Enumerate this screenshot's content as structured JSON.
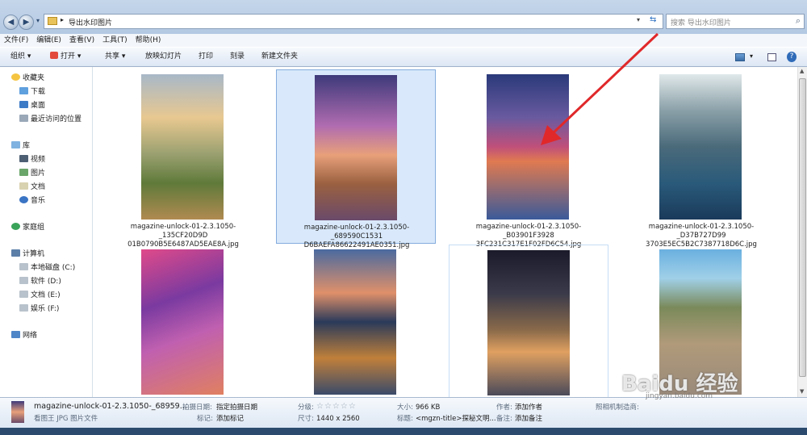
{
  "address": {
    "path": "导出水印图片",
    "search_placeholder": "搜索 导出水印图片"
  },
  "menu": [
    "文件(F)",
    "编辑(E)",
    "查看(V)",
    "工具(T)",
    "帮助(H)"
  ],
  "toolbar": {
    "organize": "组织",
    "open": "打开",
    "share": "共享",
    "slideshow": "放映幻灯片",
    "print": "打印",
    "burn": "刻录",
    "new_folder": "新建文件夹"
  },
  "sidebar": {
    "favorites": "收藏夹",
    "downloads": "下载",
    "desktop": "桌面",
    "recent": "最近访问的位置",
    "libraries": "库",
    "videos": "视频",
    "pictures": "图片",
    "documents": "文档",
    "music": "音乐",
    "homegroup": "家庭组",
    "computer": "计算机",
    "drive_c": "本地磁盘 (C:)",
    "drive_d": "软件 (D:)",
    "drive_e": "文档 (E:)",
    "drive_f": "娱乐 (F:)",
    "network": "网络"
  },
  "files": [
    {
      "line1": "magazine-unlock-01-2.3.1050-_135CF20D9D",
      "line2": "01B0790B5E6487AD5EAE8A.jpg"
    },
    {
      "line1": "magazine-unlock-01-2.3.1050-_689590C1531",
      "line2": "D6BAEFA86622491AE0351.jpg"
    },
    {
      "line1": "magazine-unlock-01-2.3.1050-_B03901F3928",
      "line2": "3FC231C317E1F02FD6C54.jpg"
    },
    {
      "line1": "magazine-unlock-01-2.3.1050-_D37B727D99",
      "line2": "3703E5EC5B2C7387718D6C.jpg"
    }
  ],
  "status": {
    "filename": "magazine-unlock-01-2.3.1050-_68959...",
    "filetype": "看图王 JPG 图片文件",
    "date_label": "拍摄日期:",
    "date_value": "指定拍摄日期",
    "tag_label": "标记:",
    "tag_value": "添加标记",
    "rating_label": "分级:",
    "size_label": "大小:",
    "size_value": "966 KB",
    "dim_label": "尺寸:",
    "dim_value": "1440 x 2560",
    "title_label": "标题:",
    "title_value": "<mgzn-title>探秘文明...",
    "author_label": "作者:",
    "author_value": "添加作者",
    "note_label": "备注:",
    "note_value": "添加备注",
    "camera_label": "照相机制造商:"
  },
  "watermark": {
    "brand": "Baidu 经验",
    "url": "jingyan.baidu.com"
  },
  "rating_stars": 0
}
